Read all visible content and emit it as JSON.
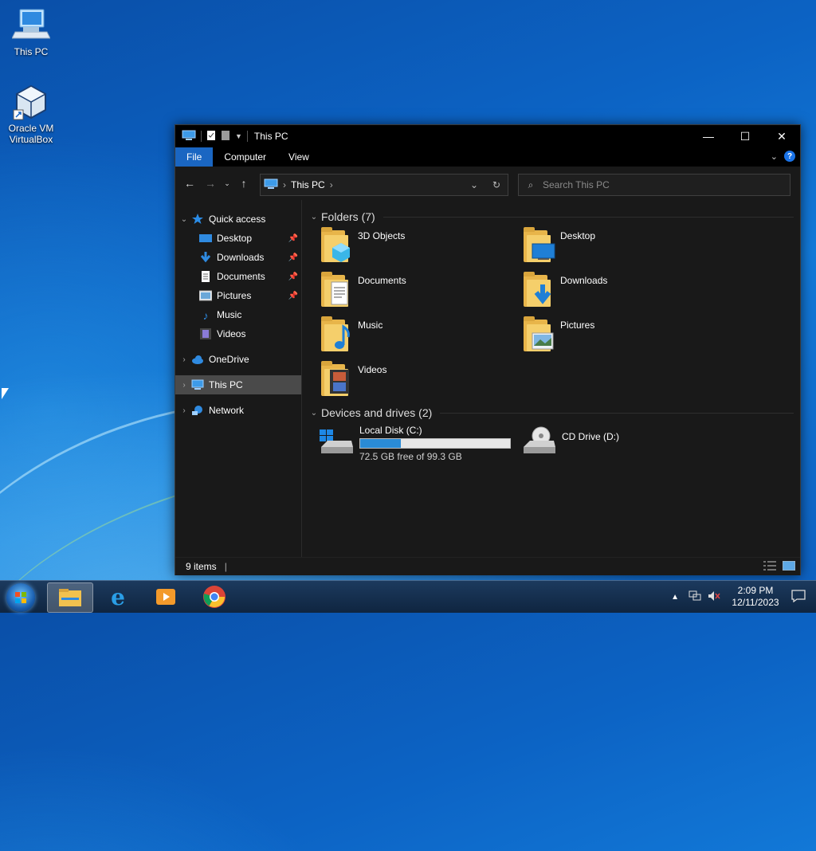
{
  "desktop": {
    "icons": [
      {
        "label": "This PC"
      },
      {
        "label_line1": "Oracle VM",
        "label_line2": "VirtualBox"
      }
    ]
  },
  "window": {
    "title": "This PC",
    "controls": {
      "minimize": "—",
      "maximize": "☐",
      "close": "✕"
    },
    "ribbon_tabs": [
      "File",
      "Computer",
      "View"
    ],
    "help_label": "?",
    "address": {
      "crumb": "This PC",
      "sep": "›"
    },
    "search": {
      "placeholder": "Search This PC"
    },
    "nav": {
      "quick_access": "Quick access",
      "pinned": [
        "Desktop",
        "Downloads",
        "Documents",
        "Pictures"
      ],
      "unpinned": [
        "Music",
        "Videos"
      ],
      "onedrive": "OneDrive",
      "this_pc": "This PC",
      "network": "Network"
    },
    "folders_header": "Folders (7)",
    "folders": [
      "3D Objects",
      "Desktop",
      "Documents",
      "Downloads",
      "Music",
      "Pictures",
      "Videos"
    ],
    "drives_header": "Devices and drives (2)",
    "drives": [
      {
        "name": "Local Disk (C:)",
        "free_text": "72.5 GB free of 99.3 GB",
        "used_fraction": 0.27
      },
      {
        "name": "CD Drive (D:)"
      }
    ],
    "status_text": "9 items"
  },
  "taskbar": {
    "time": "2:09 PM",
    "date": "12/11/2023"
  },
  "colors": {
    "accent": "#1a66c2",
    "selected_nav": "#4a4a4a",
    "disk_fill": "#2a8bd6"
  }
}
